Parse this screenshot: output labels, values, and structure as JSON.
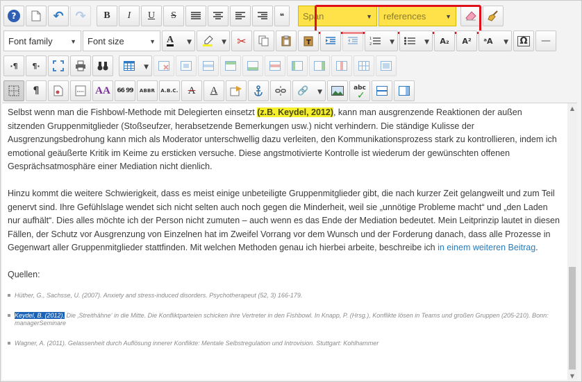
{
  "toolbar": {
    "row1": {
      "help": "?",
      "new_doc": "□",
      "undo": "↶",
      "redo": "↷",
      "bold": "B",
      "italic": "I",
      "underline": "U",
      "strike": "S",
      "blockquote": "❝",
      "span_combo": "Span",
      "references_combo": "references",
      "eraser": "✎",
      "cleanup": "🧹"
    },
    "row2": {
      "font_family": "Font family",
      "font_size": "Font size",
      "text_color": "A",
      "highlight": "✎",
      "cut": "✂",
      "copy": "⎘",
      "paste": "📋",
      "paste_text": "T",
      "subscript": "A₂",
      "superscript": "A²",
      "case": "ᵃA",
      "special_char": "Ω",
      "hr": "—"
    },
    "row3": {
      "ltr": "·¶",
      "rtl": "¶·",
      "fullscreen": "⛶",
      "print": "🖶",
      "find": "🔍"
    },
    "row4": {
      "pilcrow": "¶",
      "styles": "AA",
      "quote": "66 99",
      "abbr": "ABBR",
      "acronym": "A.B.C.",
      "strike_a": "A",
      "underline_a": "A",
      "link": "🔗",
      "spell": "abc"
    }
  },
  "content": {
    "p1_before": "Selbst wenn man die Fishbowl-Methode mit Delegierten einsetzt ",
    "p1_highlight": "(z.B. Keydel, 2012)",
    "p1_after": ", kann man ausgrenzende Reaktionen der außen sitzenden Gruppenmitglieder (Stoßseufzer, herabsetzende Bemerkungen usw.) nicht verhindern. Die ständige Kulisse der Ausgrenzungsbedrohung kann mich als Moderator unterschwellig dazu verleiten, den Kommunikationsprozess stark zu kontrollieren, indem ich emotional geäußerte Kritik im Keime zu ersticken versuche. Diese angstmotivierte Kontrolle ist wiederum der gewünschten offenen Gesprächsatmosphäre einer Mediation nicht dienlich.",
    "p2_before": "Hinzu kommt die weitere Schwierigkeit, dass es meist einige unbeteiligte Gruppenmitglieder gibt, die nach kurzer Zeit gelangweilt und zum Teil genervt sind. Ihre Gefühlslage wendet sich nicht selten auch noch gegen die Minderheit, weil sie „unnötige Probleme macht“ und „den Laden nur aufhält“. Dies alles möchte ich der Person nicht zumuten – auch wenn es das Ende der Mediation bedeutet. Mein Leitprinzip lautet in diesen Fällen, der Schutz vor Ausgrenzung von Einzelnen hat im Zweifel Vorrang vor  dem Wunsch und der Forderung danach, dass alle Prozesse in Gegenwart aller Gruppenmitglieder stattfinden. Mit welchen Methoden genau ich hierbei arbeite, beschreibe ich ",
    "p2_link": "in einem weiteren Beitrag",
    "p2_after": ".",
    "sources_heading": "Quellen:",
    "ref1": "Hüther, G., Sachsse, U. (2007). Anxiety and stress-induced disorders. Psychotherapeut (52, 3) 166-179.",
    "ref2_selected": "Keydel, B. (2012).",
    "ref2_rest": " Die ‚Streithähne‘ in die Mitte. Die Konfliktparteien schicken ihre Vertreter in den Fishbowl. In Knapp, P. (Hrsg.), Konflikte lösen in Teams und großen Gruppen (205-210). Bonn: managerSeminare",
    "ref3": "Wagner, A. (2011). Gelassenheit durch Auflösung innerer Konflikte: Mentale Selbstregulation und Introvision. Stuttgart: Kohlhammer"
  },
  "colors": {
    "highlight": "#f6ef2c",
    "combo_yellow": "#ffe24a",
    "red_frame": "#e0101a",
    "link": "#2a7ab8",
    "selection": "#1a62b8"
  }
}
